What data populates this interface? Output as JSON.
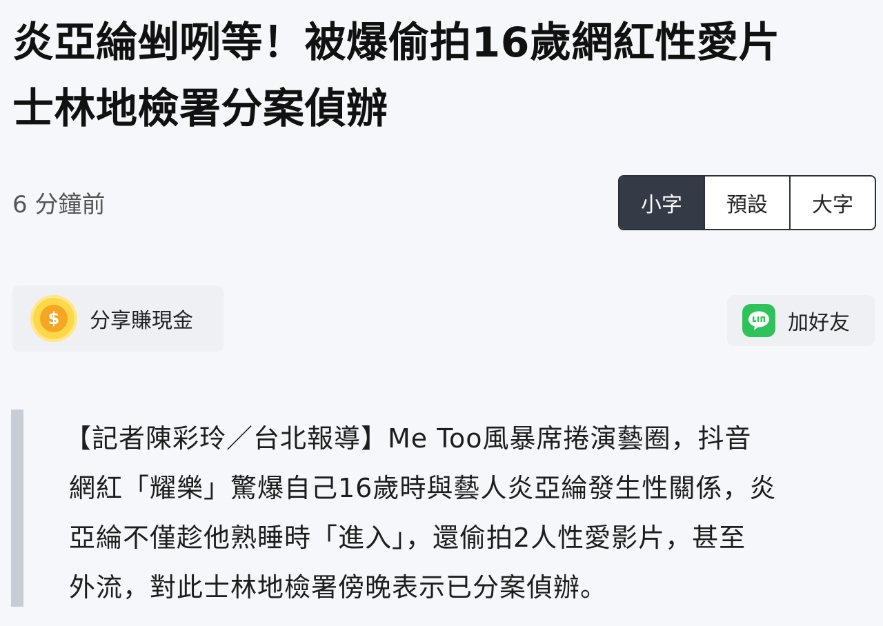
{
  "headline": {
    "line1": "炎亞綸剉咧等！被爆偷拍16歲網紅性愛片",
    "line2": "士林地檢署分案偵辦"
  },
  "meta": {
    "timestamp": "6 分鐘前"
  },
  "font_size_options": {
    "small": "小字",
    "default": "預設",
    "large": "大字",
    "active": "small"
  },
  "share": {
    "label": "分享賺現金",
    "coin_symbol": "$"
  },
  "line_friend": {
    "label": "加好友",
    "icon_text": "LINE"
  },
  "article": {
    "lines": [
      "【記者陳彩玲／台北報導】Me Too風暴席捲演藝圈，抖音",
      "網紅「耀樂」驚爆自己16歲時與藝人炎亞綸發生性關係，炎",
      "亞綸不僅趁他熟睡時「進入」，還偷拍2人性愛影片，甚至",
      "外流，對此士林地檢署傍晚表示已分案偵辦。"
    ]
  },
  "colors": {
    "background": "#f6f7fb",
    "active_button": "#353a47",
    "line_green": "#2ec35a",
    "coin_yellow": "#ffd84a",
    "quote_bar": "#c7ccd6"
  }
}
